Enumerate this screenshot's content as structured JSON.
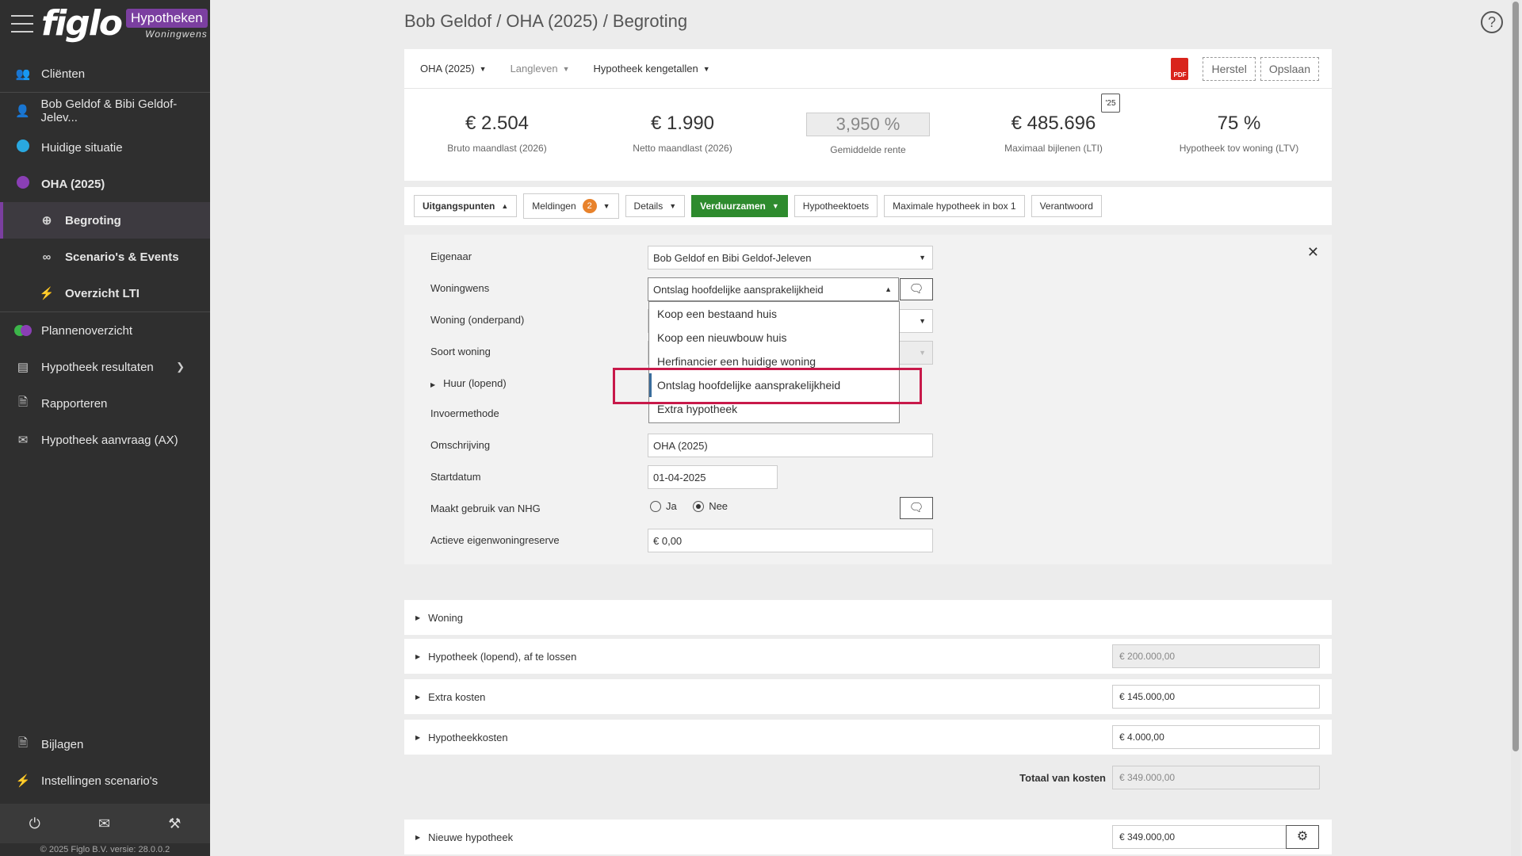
{
  "app": {
    "logo": "figlo",
    "brand_tag": "Hypotheken",
    "brand_sub": "Woningwens",
    "copyright": "© 2025 Figlo B.V. versie: 28.0.0.2"
  },
  "sidebar": {
    "items": [
      {
        "label": "Cliënten"
      },
      {
        "label": "Bob Geldof & Bibi Geldof-Jelev..."
      },
      {
        "label": "Huidige situatie"
      },
      {
        "label": "OHA (2025)"
      },
      {
        "label": "Begroting"
      },
      {
        "label": "Scenario's & Events"
      },
      {
        "label": "Overzicht LTI"
      },
      {
        "label": "Plannenoverzicht"
      },
      {
        "label": "Hypotheek resultaten"
      },
      {
        "label": "Rapporteren"
      },
      {
        "label": "Hypotheek aanvraag (AX)"
      },
      {
        "label": "Bijlagen"
      },
      {
        "label": "Instellingen scenario's"
      }
    ]
  },
  "page": {
    "title": "Bob Geldof / OHA (2025) / Begroting"
  },
  "toolbar": {
    "dd1": "OHA (2025)",
    "dd2": "Langleven",
    "dd3": "Hypotheek kengetallen",
    "pdf": "PDF",
    "herstel": "Herstel",
    "opslaan": "Opslaan"
  },
  "kpis": [
    {
      "value": "€ 2.504",
      "label": "Bruto maandlast (2026)"
    },
    {
      "value": "€ 1.990",
      "label": "Netto maandlast (2026)"
    },
    {
      "value": "3,950 %",
      "label": "Gemiddelde rente"
    },
    {
      "value": "€ 485.696",
      "label": "Maximaal bijlenen (LTI)",
      "badge": "'25"
    },
    {
      "value": "75 %",
      "label": "Hypotheek tov woning (LTV)"
    }
  ],
  "tabs": {
    "uitgangspunten": "Uitgangspunten",
    "meldingen": "Meldingen",
    "meldingen_count": "2",
    "details": "Details",
    "verduurzamen": "Verduurzamen",
    "hypotheektoets": "Hypotheektoets",
    "max_box1": "Maximale hypotheek in box 1",
    "verantwoord": "Verantwoord"
  },
  "form": {
    "eigenaar_label": "Eigenaar",
    "eigenaar_value": "Bob Geldof en Bibi Geldof-Jeleven",
    "woningwens_label": "Woningwens",
    "woningwens_value": "Ontslag hoofdelijke aansprakelijkheid",
    "woning_label": "Woning (onderpand)",
    "soort_label": "Soort woning",
    "huur_label": "Huur (lopend)",
    "invoer_label": "Invoermethode",
    "omschrijving_label": "Omschrijving",
    "omschrijving_value": "OHA (2025)",
    "startdatum_label": "Startdatum",
    "startdatum_value": "01-04-2025",
    "nhg_label": "Maakt gebruik van NHG",
    "nhg_ja": "Ja",
    "nhg_nee": "Nee",
    "reserve_label": "Actieve eigenwoningreserve",
    "reserve_value": "0,00",
    "currency": "€"
  },
  "dropdown": {
    "options": [
      "Koop een bestaand huis",
      "Koop een nieuwbouw huis",
      "Herfinancier een huidige woning",
      "Ontslag hoofdelijke aansprakelijkheid",
      "Extra hypotheek"
    ],
    "selected": "Ontslag hoofdelijke aansprakelijkheid"
  },
  "sections": {
    "woning": "Woning",
    "hypotheek_lopend": "Hypotheek (lopend), af te lossen",
    "hypotheek_lopend_value": "200.000,00",
    "extra_kosten": "Extra kosten",
    "extra_kosten_value": "145.000,00",
    "hypotheekkosten": "Hypotheekkosten",
    "hypotheekkosten_value": "4.000,00",
    "totaal_label": "Totaal van kosten",
    "totaal_value": "349.000,00",
    "nieuwe_hypotheek": "Nieuwe hypotheek",
    "nieuwe_hypotheek_value": "349.000,00"
  },
  "colors": {
    "sidebar_bg": "#2f2f2f",
    "brand_purple": "#7b3fa0",
    "green_button": "#2e8b2e",
    "badge_orange": "#e8822b",
    "highlight_red": "#c8194a",
    "dot_blue": "#29a8e0",
    "dot_purple": "#8a3fb5",
    "dot_green": "#3cb54a"
  }
}
